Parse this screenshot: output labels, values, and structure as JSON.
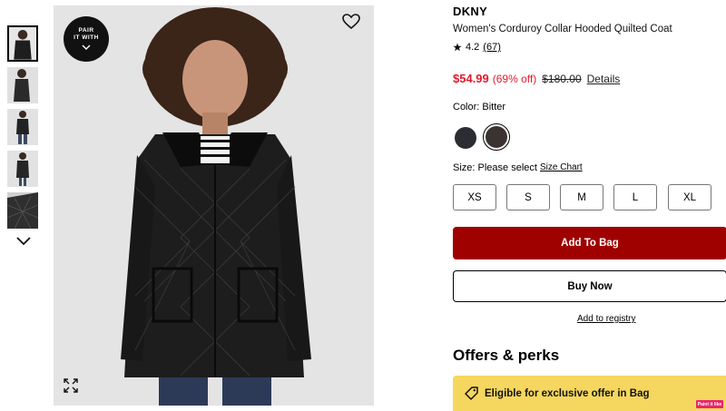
{
  "gallery": {
    "pair_badge_line1": "PAIR",
    "pair_badge_line2": "IT WITH",
    "icons": [
      "chevron-down-icon",
      "heart-icon",
      "expand-icon"
    ]
  },
  "product": {
    "brand": "DKNY",
    "title": "Women's Corduroy Collar Hooded Quilted Coat",
    "rating": "4.2",
    "review_count": "(67)",
    "sale_price": "$54.99",
    "discount": "(69% off)",
    "original_price": "$180.00",
    "details_link": "Details"
  },
  "color": {
    "label": "Color: Bitter",
    "swatches": [
      {
        "name": "navy",
        "hex": "#2b2d33"
      },
      {
        "name": "Bitter",
        "hex": "#3a3330"
      }
    ]
  },
  "size": {
    "label": "Size: Please select",
    "chart_link": "Size Chart",
    "options": [
      "XS",
      "S",
      "M",
      "L",
      "XL"
    ]
  },
  "actions": {
    "add_to_bag": "Add To Bag",
    "buy_now": "Buy Now",
    "add_registry": "Add to registry"
  },
  "offers": {
    "title": "Offers & perks",
    "banner": "Eligible for exclusive offer in Bag"
  },
  "badge": {
    "label": "Paint it like"
  },
  "colors": {
    "sale_red": "#e11a2b",
    "add_to_bag_bg": "#9f0000",
    "offer_yellow": "#f5d75f"
  }
}
